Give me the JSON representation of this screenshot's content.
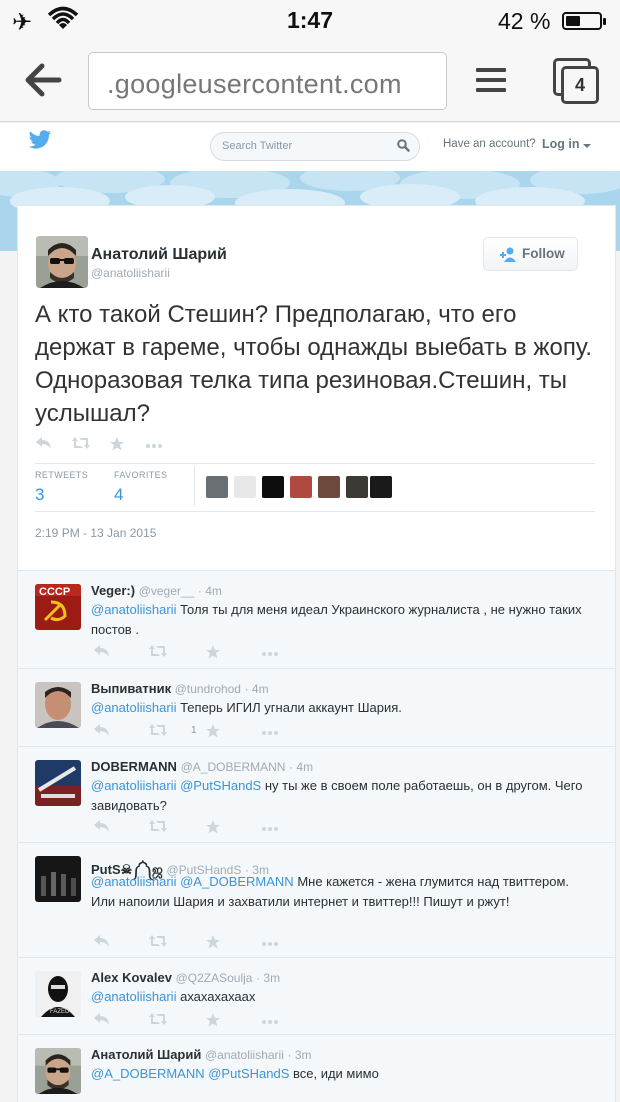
{
  "status": {
    "time": "1:47",
    "battery": "42 %",
    "battery_level": 0.42
  },
  "browser": {
    "url": ".googleusercontent.com",
    "tab_count": "4"
  },
  "twitter": {
    "search_placeholder": "Search Twitter",
    "have_account": "Have an account?",
    "login": "Log in"
  },
  "tweet": {
    "name": "Анатолий Шарий",
    "handle": "@anatoliisharii",
    "follow_label": "Follow",
    "text": "А кто такой Стешин? Предполагаю, что его держат в гареме, чтобы однажды выебать в жопу. Одноразовая телка типа резиновая.Стешин, ты услышал?",
    "retweets_label": "RETWEETS",
    "retweets": "3",
    "favorites_label": "FAVORITES",
    "favorites": "4",
    "timestamp": "2:19 PM - 13 Jan 2015"
  },
  "replies": [
    {
      "name": "Veger:)",
      "handle": "@veger__",
      "age": "· 4m",
      "mention": "@anatoliisharii",
      "mention2": "",
      "text": "Толя ты для меня идеал Украинского журналиста , не нужно таких постов .",
      "count": ""
    },
    {
      "name": "Выпиватник",
      "handle": "@tundrohod",
      "age": "· 4m",
      "mention": "@anatoliisharii",
      "mention2": "",
      "text": "Теперь ИГИЛ угнали аккаунт Шария.",
      "count": "1"
    },
    {
      "name": "DOBERMANN",
      "handle": "@A_DOBERMANN",
      "age": "· 4m",
      "mention": "@anatoliisharii",
      "mention2": "@PutSHandS",
      "text": "ну ты же в своем поле работаешь, он в другом. Чего завидовать?",
      "count": ""
    },
    {
      "name": "PutS☠༼༽ஜ",
      "handle": "@PutSHandS",
      "age": "· 3m",
      "mention": "@anatoliisharii",
      "mention2": "@A_DOBERMANN",
      "text": "Мне кажется - жена глумится над твиттером. Или напоили Шария и захватили интернет и твиттер!!! Пишут и ржут!",
      "count": ""
    },
    {
      "name": "Alex Kovalev",
      "handle": "@Q2ZASoulja",
      "age": "· 3m",
      "mention": "@anatoliisharii",
      "mention2": "",
      "text": "ахахахахаах",
      "count": ""
    },
    {
      "name": "Анатолий Шарий",
      "handle": "@anatoliisharii",
      "age": "· 3m",
      "mention": "@A_DOBERMANN",
      "mention2": "@PutSHandS",
      "text": "все, иди мимо",
      "count": ""
    }
  ]
}
